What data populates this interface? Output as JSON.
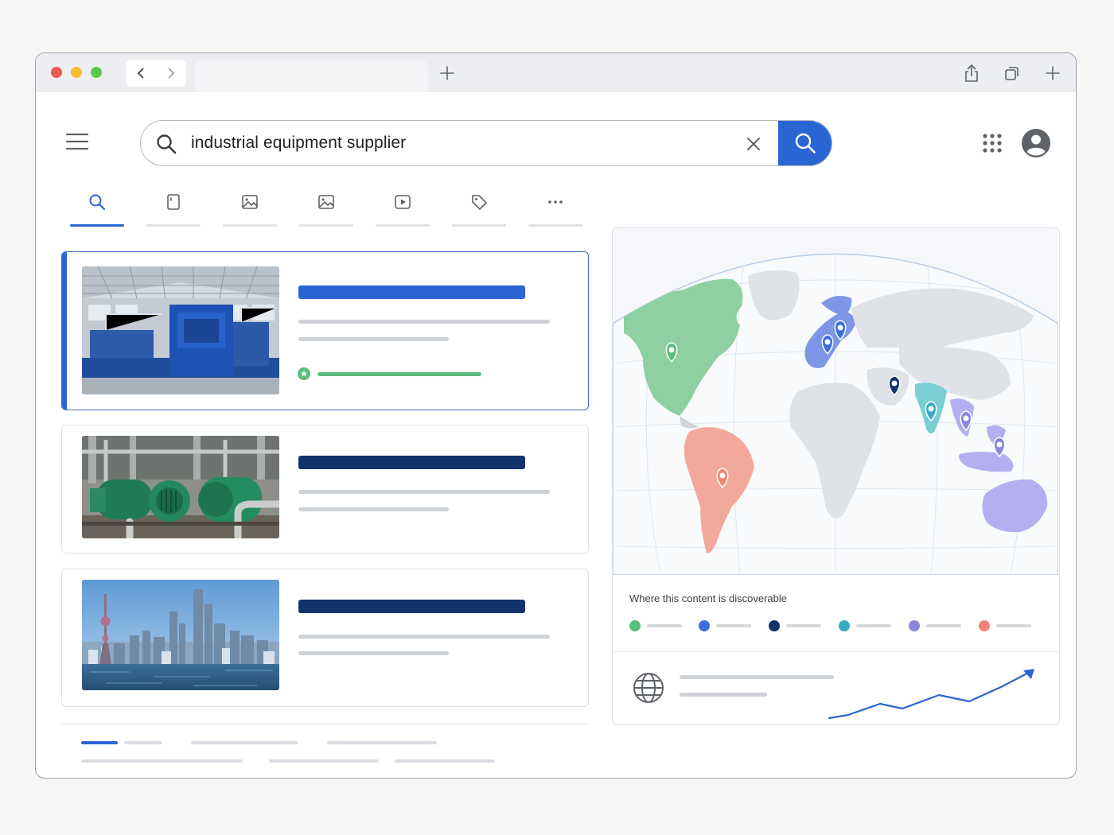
{
  "search": {
    "query": "industrial equipment supplier"
  },
  "icons": {
    "menu": "hamburger-menu-icon",
    "search": "search-icon",
    "clear": "close-icon",
    "apps": "apps-grid-icon",
    "account": "account-avatar-icon",
    "share": "share-icon",
    "tabs": "tabs-icon",
    "new_tab": "plus-icon"
  },
  "filter_tabs": [
    {
      "icon": "search-icon",
      "active": true
    },
    {
      "icon": "document-icon",
      "active": false
    },
    {
      "icon": "image-icon",
      "active": false
    },
    {
      "icon": "image-icon",
      "active": false
    },
    {
      "icon": "video-play-icon",
      "active": false
    },
    {
      "icon": "tag-icon",
      "active": false
    },
    {
      "icon": "more-dots-icon",
      "active": false
    }
  ],
  "results": [
    {
      "image": "factory-hall-blue-machinery",
      "selected": true,
      "verified": true
    },
    {
      "image": "green-industrial-pumps",
      "selected": false,
      "verified": false
    },
    {
      "image": "city-skyline-waterfront",
      "selected": false,
      "verified": false
    }
  ],
  "map": {
    "legend_title": "Where this content is discoverable",
    "legend_colors": [
      "#5bbd7a",
      "#3e6fd8",
      "#13336b",
      "#3aaabf",
      "#8c86d9",
      "#ef8474"
    ],
    "markers": [
      {
        "region": "North America",
        "color": "#5bbd7a"
      },
      {
        "region": "Western Europe",
        "color": "#3e6fd8"
      },
      {
        "region": "Northern Europe",
        "color": "#3e6fd8"
      },
      {
        "region": "Middle East",
        "color": "#13336b"
      },
      {
        "region": "India",
        "color": "#3aaabf"
      },
      {
        "region": "Southeast Asia",
        "color": "#8c86d9"
      },
      {
        "region": "Indonesia",
        "color": "#8c86d9"
      },
      {
        "region": "South America",
        "color": "#ef8474"
      }
    ]
  },
  "colors": {
    "accent": "#2a65d4",
    "title_bar_selected": "#2a65d4",
    "title_bar": "#13336b",
    "verified": "#5bbd7a"
  }
}
